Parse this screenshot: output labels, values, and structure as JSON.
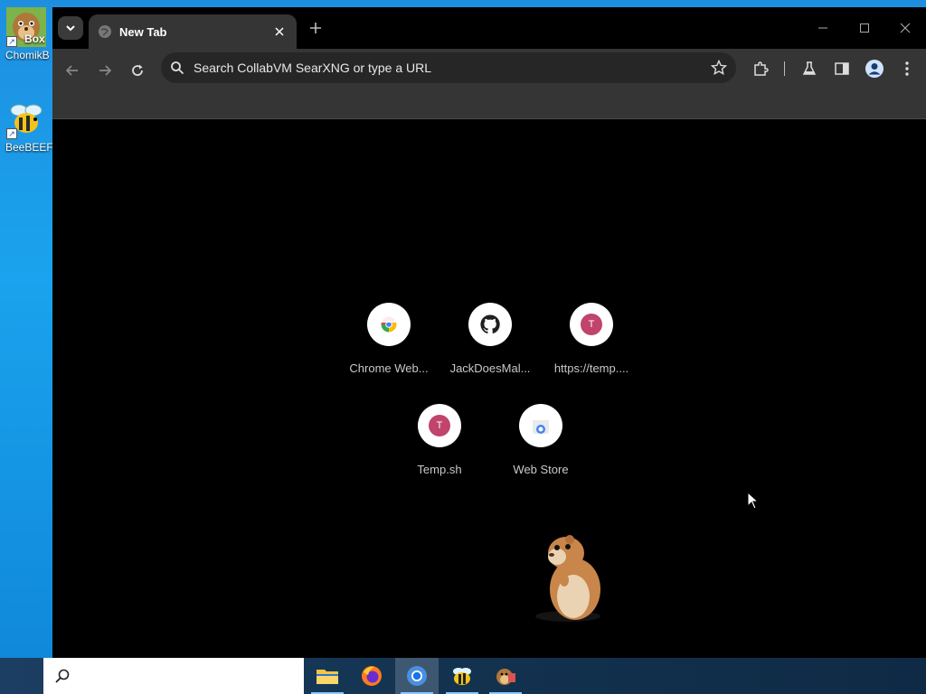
{
  "desktop": {
    "icons": [
      {
        "label": "ChomikB",
        "overlay": "Box"
      },
      {
        "label": "BeeBEEF"
      }
    ]
  },
  "browser": {
    "tab": {
      "title": "New Tab"
    },
    "omnibox": {
      "placeholder": "Search CollabVM SearXNG or type a URL"
    },
    "shortcuts": [
      {
        "name": "Chrome Web...",
        "icon": "chrome-logo-icon"
      },
      {
        "name": "JackDoesMal...",
        "icon": "github-icon"
      },
      {
        "name": "https://temp....",
        "icon": "letter-badge",
        "letter": "T"
      },
      {
        "name": "Temp.sh",
        "icon": "letter-badge",
        "letter": "T"
      },
      {
        "name": "Web Store",
        "icon": "web-store-icon"
      }
    ]
  },
  "taskbar": {
    "search_placeholder": "",
    "apps": [
      "file-explorer-icon",
      "firefox-icon",
      "chrome-icon",
      "beebeef-icon",
      "chomikbox-icon"
    ]
  },
  "colors": {
    "browser_bg": "#000000",
    "toolbar": "#353535",
    "letter_badge": "#c0446b"
  }
}
